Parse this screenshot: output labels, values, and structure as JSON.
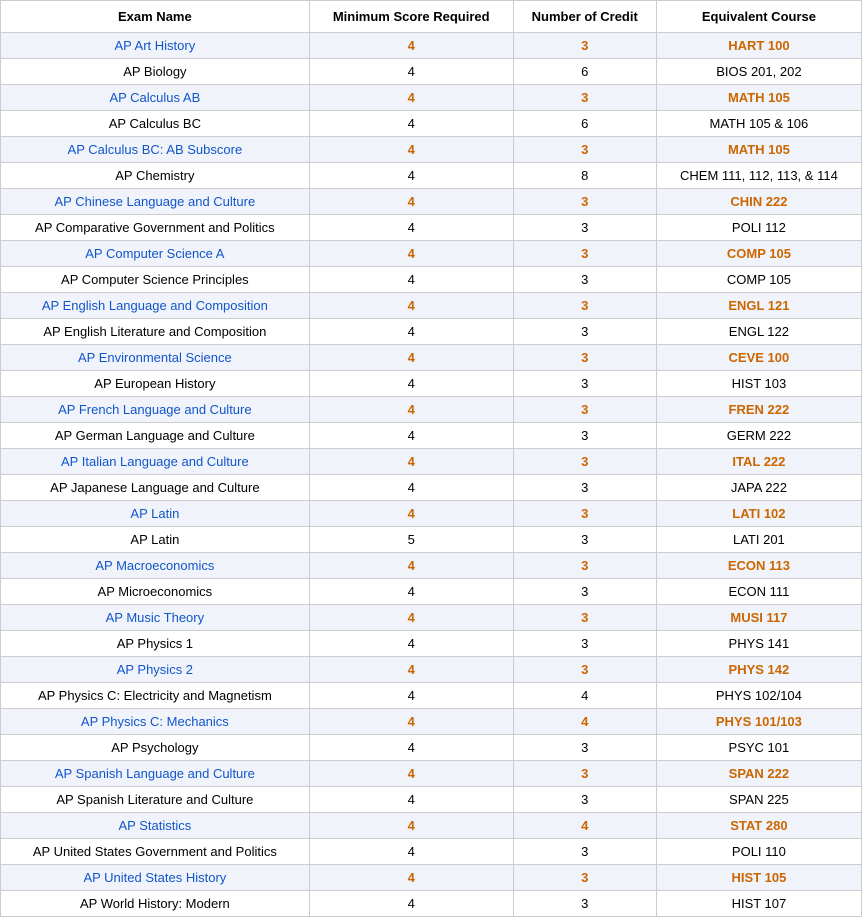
{
  "table": {
    "headers": [
      "Exam Name",
      "Minimum Score Required",
      "Number of Credit",
      "Equivalent Course"
    ],
    "rows": [
      {
        "name": "AP Art History",
        "highlighted": true,
        "min_score": "4",
        "credits": "3",
        "course": "HART 100",
        "course_highlighted": true
      },
      {
        "name": "AP Biology",
        "highlighted": false,
        "min_score": "4",
        "credits": "6",
        "course": "BIOS 201, 202",
        "course_highlighted": false
      },
      {
        "name": "AP Calculus AB",
        "highlighted": true,
        "min_score": "4",
        "credits": "3",
        "course": "MATH 105",
        "course_highlighted": true
      },
      {
        "name": "AP Calculus BC",
        "highlighted": false,
        "min_score": "4",
        "credits": "6",
        "course": "MATH 105 & 106",
        "course_highlighted": false
      },
      {
        "name": "AP Calculus BC: AB Subscore",
        "highlighted": true,
        "min_score": "4",
        "credits": "3",
        "course": "MATH 105",
        "course_highlighted": true
      },
      {
        "name": "AP Chemistry",
        "highlighted": false,
        "min_score": "4",
        "credits": "8",
        "course": "CHEM 111, 112, 113, & 114",
        "course_highlighted": false
      },
      {
        "name": "AP Chinese Language and Culture",
        "highlighted": true,
        "min_score": "4",
        "credits": "3",
        "course": "CHIN 222",
        "course_highlighted": true
      },
      {
        "name": "AP Comparative Government and Politics",
        "highlighted": false,
        "min_score": "4",
        "credits": "3",
        "course": "POLI 112",
        "course_highlighted": false
      },
      {
        "name": "AP Computer Science A",
        "highlighted": true,
        "min_score": "4",
        "credits": "3",
        "course": "COMP 105",
        "course_highlighted": true
      },
      {
        "name": "AP Computer Science Principles",
        "highlighted": false,
        "min_score": "4",
        "credits": "3",
        "course": "COMP 105",
        "course_highlighted": false
      },
      {
        "name": "AP English Language and Composition",
        "highlighted": true,
        "min_score": "4",
        "credits": "3",
        "course": "ENGL 121",
        "course_highlighted": true
      },
      {
        "name": "AP English Literature and Composition",
        "highlighted": false,
        "min_score": "4",
        "credits": "3",
        "course": "ENGL 122",
        "course_highlighted": false
      },
      {
        "name": "AP Environmental Science",
        "highlighted": true,
        "min_score": "4",
        "credits": "3",
        "course": "CEVE 100",
        "course_highlighted": true
      },
      {
        "name": "AP European History",
        "highlighted": false,
        "min_score": "4",
        "credits": "3",
        "course": "HIST 103",
        "course_highlighted": false
      },
      {
        "name": "AP French Language and Culture",
        "highlighted": true,
        "min_score": "4",
        "credits": "3",
        "course": "FREN 222",
        "course_highlighted": true
      },
      {
        "name": "AP German Language and Culture",
        "highlighted": false,
        "min_score": "4",
        "credits": "3",
        "course": "GERM 222",
        "course_highlighted": false
      },
      {
        "name": "AP Italian Language and Culture",
        "highlighted": true,
        "min_score": "4",
        "credits": "3",
        "course": "ITAL 222",
        "course_highlighted": true
      },
      {
        "name": "AP Japanese Language and Culture",
        "highlighted": false,
        "min_score": "4",
        "credits": "3",
        "course": "JAPA 222",
        "course_highlighted": false
      },
      {
        "name": "AP Latin",
        "highlighted": true,
        "min_score": "4",
        "credits": "3",
        "course": "LATI 102",
        "course_highlighted": true
      },
      {
        "name": "AP Latin",
        "highlighted": false,
        "min_score": "5",
        "credits": "3",
        "course": "LATI 201",
        "course_highlighted": false
      },
      {
        "name": "AP Macroeconomics",
        "highlighted": true,
        "min_score": "4",
        "credits": "3",
        "course": "ECON 113",
        "course_highlighted": true
      },
      {
        "name": "AP Microeconomics",
        "highlighted": false,
        "min_score": "4",
        "credits": "3",
        "course": "ECON 111",
        "course_highlighted": false
      },
      {
        "name": "AP Music Theory",
        "highlighted": true,
        "min_score": "4",
        "credits": "3",
        "course": "MUSI 117",
        "course_highlighted": true
      },
      {
        "name": "AP Physics 1",
        "highlighted": false,
        "min_score": "4",
        "credits": "3",
        "course": "PHYS 141",
        "course_highlighted": false
      },
      {
        "name": "AP Physics 2",
        "highlighted": true,
        "min_score": "4",
        "credits": "3",
        "course": "PHYS 142",
        "course_highlighted": true
      },
      {
        "name": "AP Physics C: Electricity and Magnetism",
        "highlighted": false,
        "min_score": "4",
        "credits": "4",
        "course": "PHYS 102/104",
        "course_highlighted": false
      },
      {
        "name": "AP Physics C: Mechanics",
        "highlighted": true,
        "min_score": "4",
        "credits": "4",
        "course": "PHYS 101/103",
        "course_highlighted": true
      },
      {
        "name": "AP Psychology",
        "highlighted": false,
        "min_score": "4",
        "credits": "3",
        "course": "PSYC 101",
        "course_highlighted": false
      },
      {
        "name": "AP Spanish Language and Culture",
        "highlighted": true,
        "min_score": "4",
        "credits": "3",
        "course": "SPAN 222",
        "course_highlighted": true
      },
      {
        "name": "AP Spanish Literature and Culture",
        "highlighted": false,
        "min_score": "4",
        "credits": "3",
        "course": "SPAN 225",
        "course_highlighted": false
      },
      {
        "name": "AP Statistics",
        "highlighted": true,
        "min_score": "4",
        "credits": "4",
        "course": "STAT 280",
        "course_highlighted": true
      },
      {
        "name": "AP United States Government and Politics",
        "highlighted": false,
        "min_score": "4",
        "credits": "3",
        "course": "POLI 110",
        "course_highlighted": false
      },
      {
        "name": "AP United States History",
        "highlighted": true,
        "min_score": "4",
        "credits": "3",
        "course": "HIST 105",
        "course_highlighted": true
      },
      {
        "name": "AP World History: Modern",
        "highlighted": false,
        "min_score": "4",
        "credits": "3",
        "course": "HIST 107",
        "course_highlighted": false
      }
    ]
  }
}
